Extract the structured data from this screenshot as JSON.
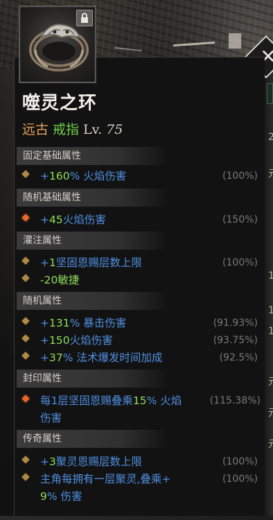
{
  "item": {
    "name": "噬灵之环",
    "rarity": "远古",
    "type": "戒指",
    "level_label": "Lv.",
    "level": "75",
    "icon": "ring-icon",
    "locked_icon": "lock-icon"
  },
  "sections": {
    "base_fixed": {
      "title": "固定基础属性",
      "affixes": [
        {
          "prefix": "+",
          "num": "160",
          "suffix": "% 火焰伤害",
          "pct": "(100%)"
        }
      ]
    },
    "base_random": {
      "title": "随机基础属性",
      "affixes": [
        {
          "prefix": "+",
          "num": "45",
          "suffix": "火焰伤害",
          "pct": "(150%)"
        }
      ]
    },
    "infused": {
      "title": "灌注属性",
      "affixes": [
        {
          "prefix": "+",
          "num": "1",
          "suffix": "坚固恩赐层数上限",
          "pct": "(100%)"
        },
        {
          "prefix": "",
          "num": "-20",
          "suffix": "敏捷",
          "pct": ""
        }
      ]
    },
    "random": {
      "title": "随机属性",
      "affixes": [
        {
          "prefix": "+",
          "num": "131",
          "suffix": "% 暴击伤害",
          "pct": "(91.93%)"
        },
        {
          "prefix": "+",
          "num": "150",
          "suffix": "火焰伤害",
          "pct": "(93.75%)"
        },
        {
          "prefix": "+",
          "num": "37",
          "suffix": "% 法术爆发时间加成",
          "pct": "(92.5%)"
        }
      ]
    },
    "sealed": {
      "title": "封印属性",
      "affixes": [
        {
          "line1_a": "每1层坚固恩赐叠乘",
          "num": "15",
          "line1_b": "% 火焰",
          "line2": "伤害",
          "pct": "(115.38%)"
        }
      ]
    },
    "legendary": {
      "title": "传奇属性",
      "affixes": [
        {
          "prefix": "+",
          "num": "3",
          "suffix": "聚灵恩赐层数上限",
          "pct": "(100%)"
        },
        {
          "line1": "主角每拥有一层聚灵,叠乘+",
          "num": "9",
          "line2_b": "% 伤害",
          "pct": "(100%)"
        }
      ]
    }
  },
  "ui": {
    "close_icon": "close-icon",
    "right_panel_chars": [
      "2",
      "1",
      "1",
      "1",
      "元",
      "元",
      "元",
      "元"
    ]
  },
  "colors": {
    "rarity": "#e3a05a",
    "item_type": "#6fcf4a",
    "affix_text": "#4f8fe0",
    "affix_number": "#8fdc5a",
    "percent": "#7a7a7a"
  }
}
